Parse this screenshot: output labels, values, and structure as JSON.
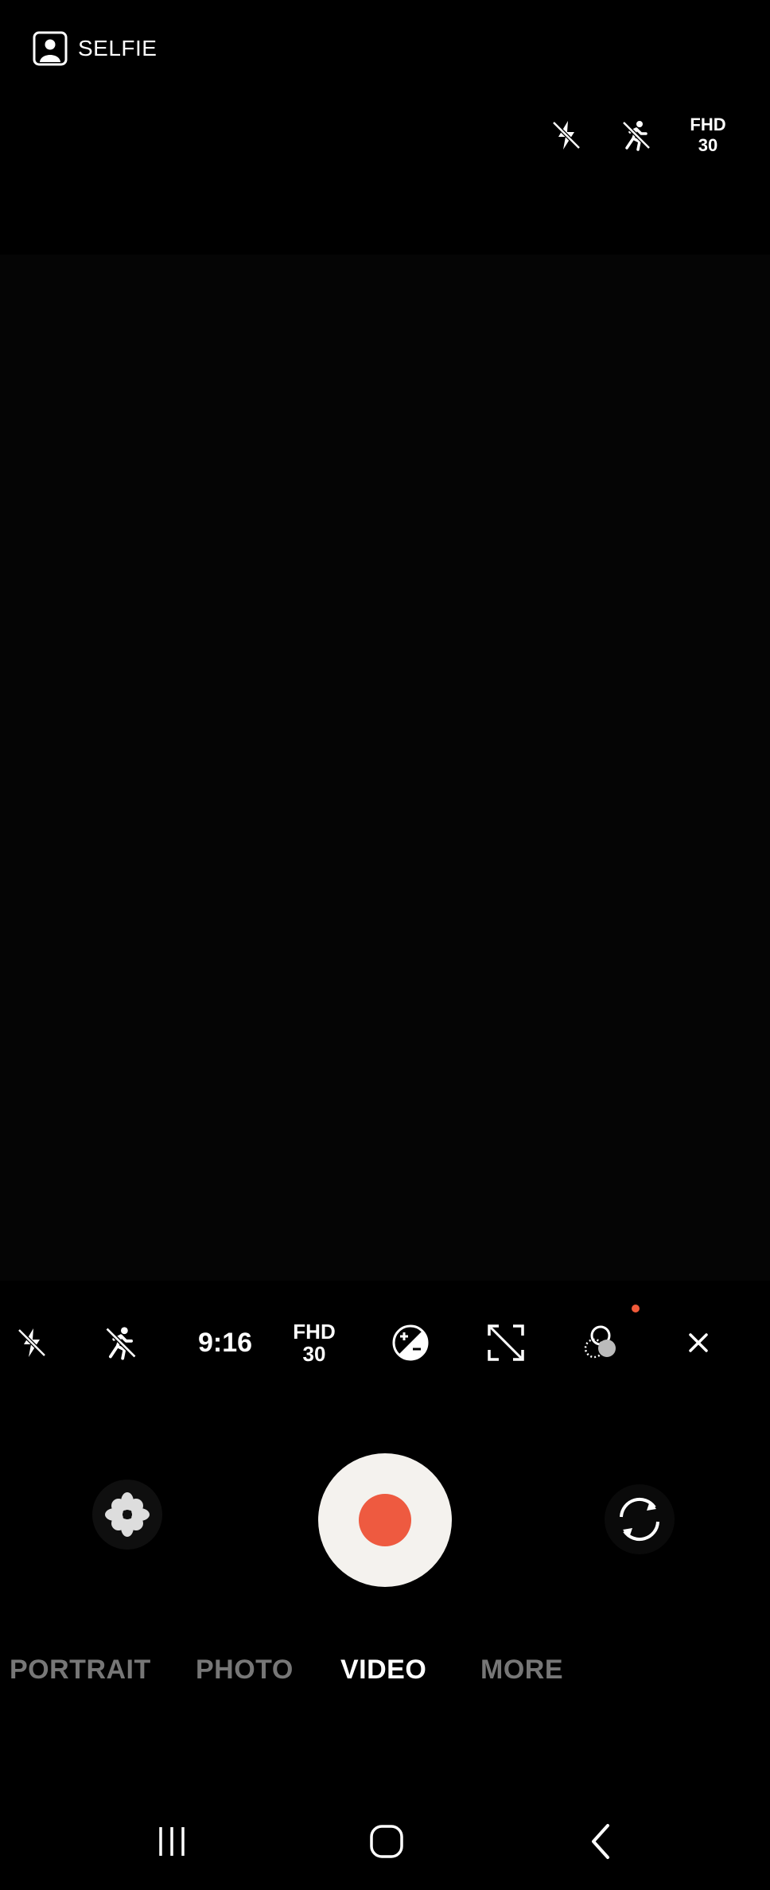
{
  "top_bar": {
    "selfie_label": "SELFIE",
    "flash_icon": "flash-off-icon",
    "motion_icon": "motion-off-icon",
    "fhd_line1": "FHD",
    "fhd_line2": "30"
  },
  "settings_strip": {
    "ratio_label": "9:16",
    "fhd_line1": "FHD",
    "fhd_line2": "30",
    "icons": [
      "flash-off-icon",
      "motion-off-icon",
      "exposure-icon",
      "auto-framing-off-icon",
      "filter-icon",
      "close-icon"
    ],
    "notification_color": "#f15a3a"
  },
  "shutter": {
    "effects_icon": "effects-flower-icon",
    "record_color": "#ee5a40",
    "switch_icon": "switch-camera-icon"
  },
  "modes": [
    "PORTRAIT",
    "PHOTO",
    "VIDEO",
    "MORE"
  ],
  "active_mode": "VIDEO",
  "navbar": {
    "icons": [
      "recent-apps-icon",
      "home-icon",
      "back-icon"
    ]
  }
}
